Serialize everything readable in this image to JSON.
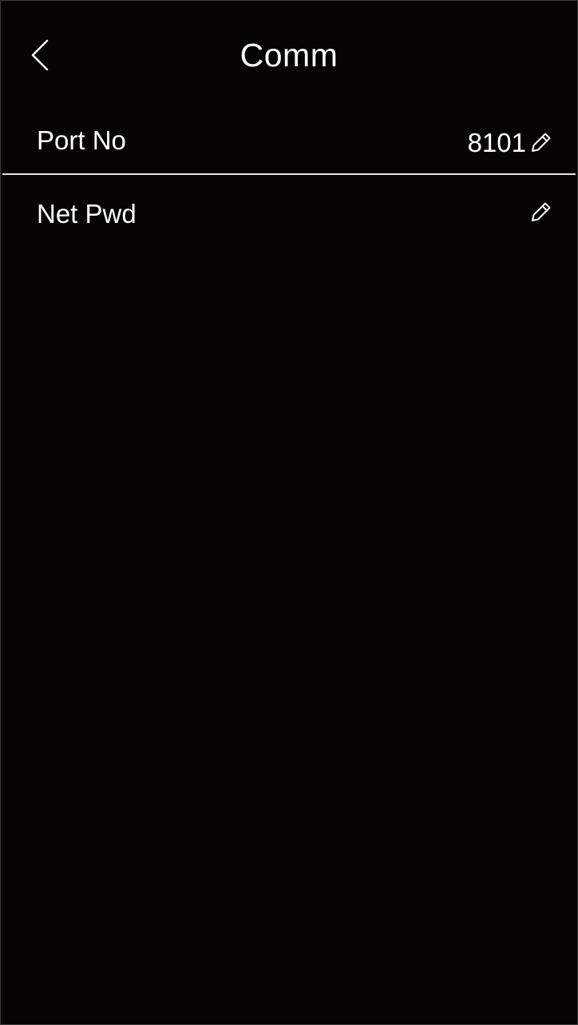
{
  "header": {
    "title": "Comm",
    "back_icon": "chevron-left-icon"
  },
  "settings": [
    {
      "label": "Port No",
      "value": "8101",
      "edit_icon": "pencil-icon"
    },
    {
      "label": "Net Pwd",
      "value": "",
      "edit_icon": "pencil-icon"
    }
  ],
  "colors": {
    "background": "#050303",
    "text": "#ffffff",
    "divider": "#e6e6e6"
  }
}
